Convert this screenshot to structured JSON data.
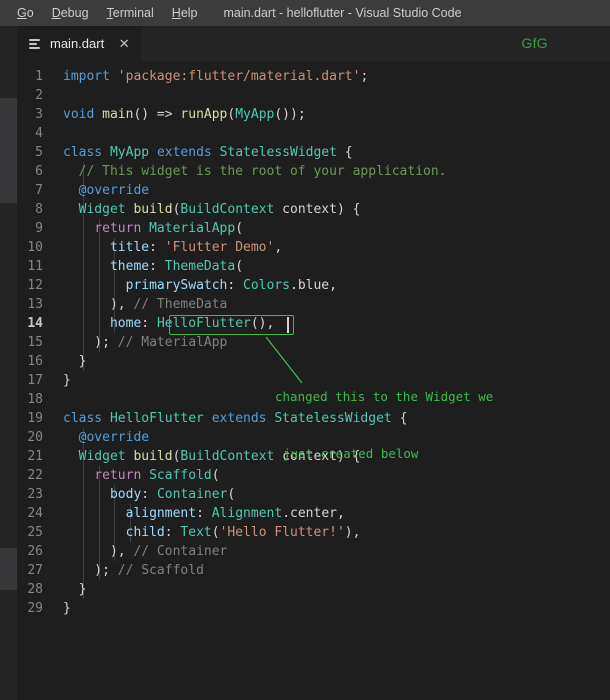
{
  "window": {
    "title": "main.dart - helloflutter - Visual Studio Code"
  },
  "menubar": {
    "items": [
      {
        "label": "Go",
        "mnemonic": "G",
        "rest": "o"
      },
      {
        "label": "Debug",
        "mnemonic": "D",
        "rest": "ebug"
      },
      {
        "label": "Terminal",
        "mnemonic": "T",
        "rest": "erminal"
      },
      {
        "label": "Help",
        "mnemonic": "H",
        "rest": "elp"
      }
    ]
  },
  "tabbar": {
    "tab_label": "main.dart",
    "close_label": "✕",
    "watermark": "GfG"
  },
  "colors": {
    "accent_green": "#3fb950",
    "watermark_green": "#2f9e45",
    "editor_background": "#1e1e1e",
    "titlebar_background": "#3c3c3c",
    "sidebar_background": "#252526",
    "keyword": "#569cd6",
    "type": "#4ec9b0",
    "function": "#dcdcaa",
    "string": "#ce9178",
    "property": "#9cdcfe",
    "comment": "#6a9955",
    "control": "#c586c0"
  },
  "editor": {
    "language": "dart",
    "active_line": 14,
    "lines": [
      {
        "n": 1,
        "tokens": [
          {
            "t": "import",
            "c": "k"
          },
          {
            "t": " ",
            "c": "pl"
          },
          {
            "t": "'package:flutter/material.dart'",
            "c": "st"
          },
          {
            "t": ";",
            "c": "pl"
          }
        ]
      },
      {
        "n": 2,
        "tokens": []
      },
      {
        "n": 3,
        "tokens": [
          {
            "t": "void",
            "c": "k"
          },
          {
            "t": " ",
            "c": "pl"
          },
          {
            "t": "main",
            "c": "fn"
          },
          {
            "t": "() => ",
            "c": "pl"
          },
          {
            "t": "runApp",
            "c": "fn"
          },
          {
            "t": "(",
            "c": "pl"
          },
          {
            "t": "MyApp",
            "c": "ct"
          },
          {
            "t": "());",
            "c": "pl"
          }
        ]
      },
      {
        "n": 4,
        "tokens": []
      },
      {
        "n": 5,
        "tokens": [
          {
            "t": "class",
            "c": "k"
          },
          {
            "t": " ",
            "c": "pl"
          },
          {
            "t": "MyApp",
            "c": "ct"
          },
          {
            "t": " ",
            "c": "pl"
          },
          {
            "t": "extends",
            "c": "k"
          },
          {
            "t": " ",
            "c": "pl"
          },
          {
            "t": "StatelessWidget",
            "c": "ct"
          },
          {
            "t": " {",
            "c": "pl"
          }
        ]
      },
      {
        "n": 6,
        "tokens": [
          {
            "t": "  // This widget is the root of your application.",
            "c": "cm"
          }
        ]
      },
      {
        "n": 7,
        "tokens": [
          {
            "t": "  ",
            "c": "pl"
          },
          {
            "t": "@override",
            "c": "an"
          }
        ]
      },
      {
        "n": 8,
        "tokens": [
          {
            "t": "  ",
            "c": "pl"
          },
          {
            "t": "Widget",
            "c": "ct"
          },
          {
            "t": " ",
            "c": "pl"
          },
          {
            "t": "build",
            "c": "fn"
          },
          {
            "t": "(",
            "c": "pl"
          },
          {
            "t": "BuildContext",
            "c": "ct"
          },
          {
            "t": " context) {",
            "c": "pl"
          }
        ]
      },
      {
        "n": 9,
        "tokens": [
          {
            "t": "    ",
            "c": "pl"
          },
          {
            "t": "return",
            "c": "rt"
          },
          {
            "t": " ",
            "c": "pl"
          },
          {
            "t": "MaterialApp",
            "c": "ct"
          },
          {
            "t": "(",
            "c": "pl"
          }
        ]
      },
      {
        "n": 10,
        "tokens": [
          {
            "t": "      ",
            "c": "pl"
          },
          {
            "t": "title",
            "c": "pr"
          },
          {
            "t": ": ",
            "c": "pl"
          },
          {
            "t": "'Flutter Demo'",
            "c": "st"
          },
          {
            "t": ",",
            "c": "pl"
          }
        ]
      },
      {
        "n": 11,
        "tokens": [
          {
            "t": "      ",
            "c": "pl"
          },
          {
            "t": "theme",
            "c": "pr"
          },
          {
            "t": ": ",
            "c": "pl"
          },
          {
            "t": "ThemeData",
            "c": "ct"
          },
          {
            "t": "(",
            "c": "pl"
          }
        ]
      },
      {
        "n": 12,
        "tokens": [
          {
            "t": "        ",
            "c": "pl"
          },
          {
            "t": "primarySwatch",
            "c": "pr"
          },
          {
            "t": ": ",
            "c": "pl"
          },
          {
            "t": "Colors",
            "c": "ct"
          },
          {
            "t": ".blue,",
            "c": "pl"
          }
        ]
      },
      {
        "n": 13,
        "tokens": [
          {
            "t": "      ), ",
            "c": "pl"
          },
          {
            "t": "// ThemeData",
            "c": "dim"
          }
        ]
      },
      {
        "n": 14,
        "tokens": [
          {
            "t": "      ",
            "c": "pl"
          },
          {
            "t": "home",
            "c": "pr"
          },
          {
            "t": ": ",
            "c": "pl"
          },
          {
            "t": "HelloFlutter",
            "c": "ct"
          },
          {
            "t": "(),",
            "c": "pl"
          }
        ]
      },
      {
        "n": 15,
        "tokens": [
          {
            "t": "    ); ",
            "c": "pl"
          },
          {
            "t": "// MaterialApp",
            "c": "dim"
          }
        ]
      },
      {
        "n": 16,
        "tokens": [
          {
            "t": "  }",
            "c": "pl"
          }
        ]
      },
      {
        "n": 17,
        "tokens": [
          {
            "t": "}",
            "c": "pl"
          }
        ]
      },
      {
        "n": 18,
        "tokens": []
      },
      {
        "n": 19,
        "tokens": [
          {
            "t": "class",
            "c": "k"
          },
          {
            "t": " ",
            "c": "pl"
          },
          {
            "t": "HelloFlutter",
            "c": "ct"
          },
          {
            "t": " ",
            "c": "pl"
          },
          {
            "t": "extends",
            "c": "k"
          },
          {
            "t": " ",
            "c": "pl"
          },
          {
            "t": "StatelessWidget",
            "c": "ct"
          },
          {
            "t": " {",
            "c": "pl"
          }
        ]
      },
      {
        "n": 20,
        "tokens": [
          {
            "t": "  ",
            "c": "pl"
          },
          {
            "t": "@override",
            "c": "an"
          }
        ]
      },
      {
        "n": 21,
        "tokens": [
          {
            "t": "  ",
            "c": "pl"
          },
          {
            "t": "Widget",
            "c": "ct"
          },
          {
            "t": " ",
            "c": "pl"
          },
          {
            "t": "build",
            "c": "fn"
          },
          {
            "t": "(",
            "c": "pl"
          },
          {
            "t": "BuildContext",
            "c": "ct"
          },
          {
            "t": " context) {",
            "c": "pl"
          }
        ]
      },
      {
        "n": 22,
        "tokens": [
          {
            "t": "    ",
            "c": "pl"
          },
          {
            "t": "return",
            "c": "rt"
          },
          {
            "t": " ",
            "c": "pl"
          },
          {
            "t": "Scaffold",
            "c": "ct"
          },
          {
            "t": "(",
            "c": "pl"
          }
        ]
      },
      {
        "n": 23,
        "tokens": [
          {
            "t": "      ",
            "c": "pl"
          },
          {
            "t": "body",
            "c": "pr"
          },
          {
            "t": ": ",
            "c": "pl"
          },
          {
            "t": "Container",
            "c": "ct"
          },
          {
            "t": "(",
            "c": "pl"
          }
        ]
      },
      {
        "n": 24,
        "tokens": [
          {
            "t": "        ",
            "c": "pl"
          },
          {
            "t": "alignment",
            "c": "pr"
          },
          {
            "t": ": ",
            "c": "pl"
          },
          {
            "t": "Alignment",
            "c": "ct"
          },
          {
            "t": ".center,",
            "c": "pl"
          }
        ]
      },
      {
        "n": 25,
        "tokens": [
          {
            "t": "        ",
            "c": "pl"
          },
          {
            "t": "child",
            "c": "pr"
          },
          {
            "t": ": ",
            "c": "pl"
          },
          {
            "t": "Text",
            "c": "ct"
          },
          {
            "t": "(",
            "c": "pl"
          },
          {
            "t": "'Hello Flutter!'",
            "c": "st"
          },
          {
            "t": "),",
            "c": "pl"
          }
        ]
      },
      {
        "n": 26,
        "tokens": [
          {
            "t": "      ), ",
            "c": "pl"
          },
          {
            "t": "// Container",
            "c": "dim"
          }
        ]
      },
      {
        "n": 27,
        "tokens": [
          {
            "t": "    ); ",
            "c": "pl"
          },
          {
            "t": "// Scaffold",
            "c": "dim"
          }
        ]
      },
      {
        "n": 28,
        "tokens": [
          {
            "t": "  }",
            "c": "pl"
          }
        ]
      },
      {
        "n": 29,
        "tokens": [
          {
            "t": "}",
            "c": "pl"
          }
        ]
      }
    ]
  },
  "annotation": {
    "line1": "changed this to the Widget we",
    "line2": "just created below"
  }
}
